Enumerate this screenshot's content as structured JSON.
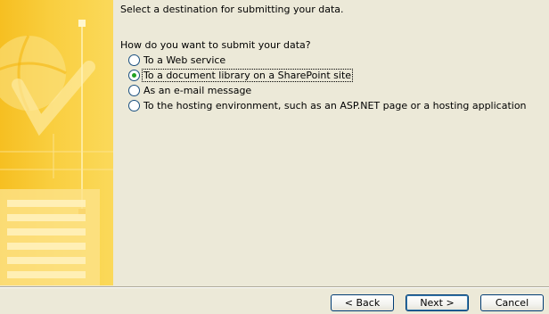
{
  "heading": "Select a destination for submitting your data.",
  "question": "How do you want to submit your data?",
  "options": [
    {
      "label": "To a Web service",
      "checked": false
    },
    {
      "label": "To a document library on a SharePoint site",
      "checked": true
    },
    {
      "label": "As an e-mail message",
      "checked": false
    },
    {
      "label": "To the hosting environment, such as an ASP.NET page or a hosting application",
      "checked": false
    }
  ],
  "buttons": {
    "back": "< Back",
    "next": "Next >",
    "cancel": "Cancel"
  },
  "colors": {
    "sidebar": "#f9c93a",
    "dialog_bg": "#ece9d8",
    "radio_dot": "#21a121",
    "button_border": "#003c74"
  }
}
